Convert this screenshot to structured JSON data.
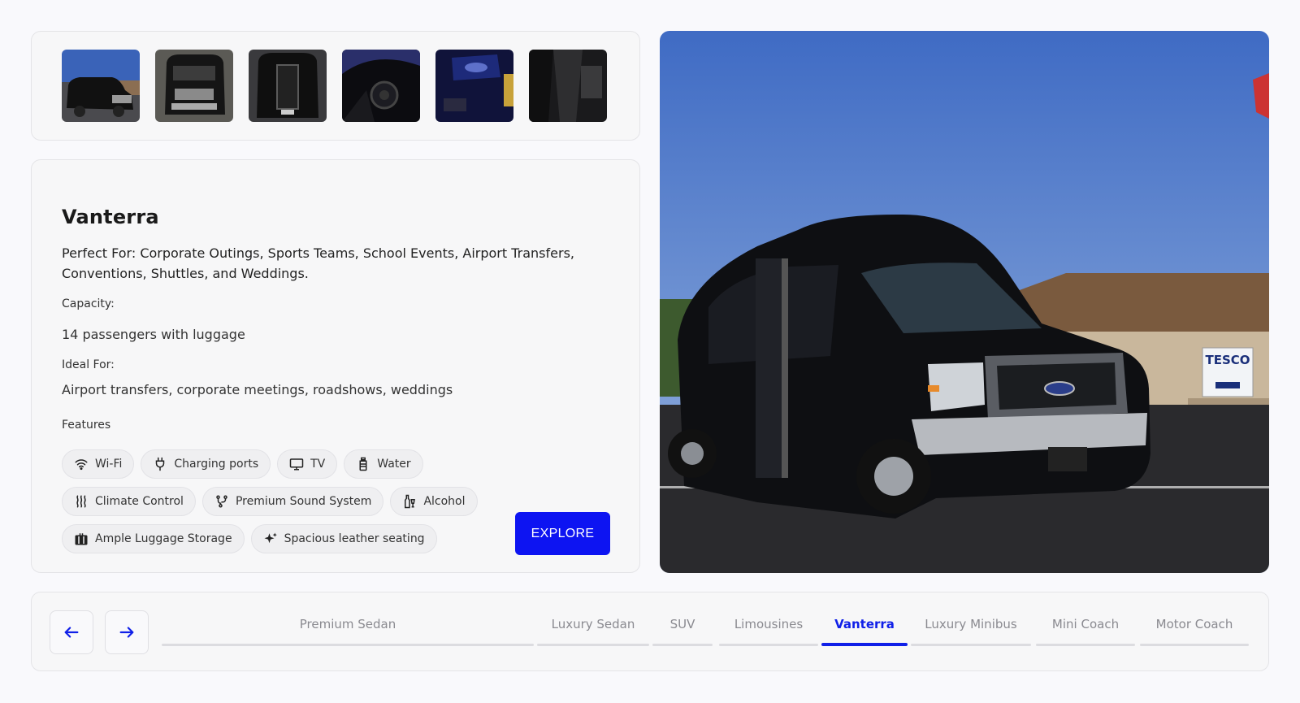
{
  "thumbnails": [
    {
      "name": "exterior-side"
    },
    {
      "name": "exterior-front"
    },
    {
      "name": "rear-door-open"
    },
    {
      "name": "interior-dash"
    },
    {
      "name": "interior-screen"
    },
    {
      "name": "interior-aisle"
    }
  ],
  "vehicle": {
    "title": "Vanterra",
    "description": "Perfect For: Corporate Outings, Sports Teams, School Events, Airport Transfers, Conventions, Shuttles, and Weddings.",
    "capacity_label": "Capacity:",
    "capacity_value": "14 passengers with luggage",
    "ideal_label": "Ideal For:",
    "ideal_value": "Airport transfers, corporate meetings, roadshows, weddings",
    "features_label": "Features",
    "features": [
      {
        "label": "Wi-Fi",
        "icon": "wifi-icon"
      },
      {
        "label": "Charging ports",
        "icon": "plug-icon"
      },
      {
        "label": "TV",
        "icon": "tv-icon"
      },
      {
        "label": "Water",
        "icon": "water-bottle-icon"
      },
      {
        "label": "Climate Control",
        "icon": "heat-waves-icon"
      },
      {
        "label": "Premium Sound System",
        "icon": "sound-system-icon"
      },
      {
        "label": "Alcohol",
        "icon": "wine-bottle-icon"
      },
      {
        "label": "Ample Luggage Storage",
        "icon": "luggage-icon"
      },
      {
        "label": "Spacious leather seating",
        "icon": "sparkle-icon"
      }
    ],
    "explore_label": "EXPLORE"
  },
  "hero": {
    "sign_text": "TESCO"
  },
  "nav": {
    "prev_icon": "arrow-left-icon",
    "next_icon": "arrow-right-icon",
    "tabs": [
      {
        "label": "Premium Sedan"
      },
      {
        "label": "Luxury Sedan"
      },
      {
        "label": "SUV"
      },
      {
        "label": "Limousines"
      },
      {
        "label": "Vanterra"
      },
      {
        "label": "Luxury Minibus"
      },
      {
        "label": "Mini Coach"
      },
      {
        "label": "Motor Coach"
      }
    ],
    "active_tab": "Vanterra"
  },
  "colors": {
    "accent": "#0d14f2",
    "active_tab": "#1020e8"
  }
}
